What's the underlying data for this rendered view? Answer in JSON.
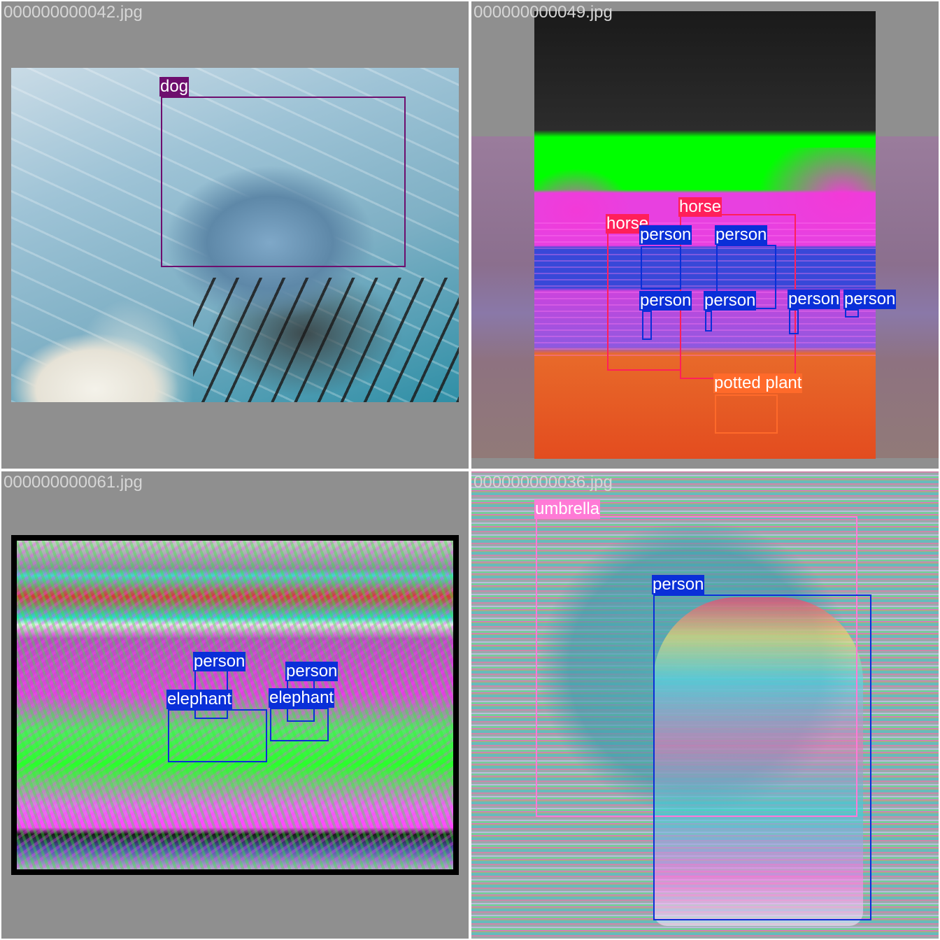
{
  "tiles": [
    {
      "filename": "000000000042.jpg",
      "detections": [
        {
          "label": "dog",
          "color": "#6e0e6e"
        }
      ]
    },
    {
      "filename": "000000000049.jpg",
      "detections": [
        {
          "label": "horse",
          "color": "#ff1f5a"
        },
        {
          "label": "horse",
          "color": "#ff1f5a"
        },
        {
          "label": "person",
          "color": "#0a2fd8"
        },
        {
          "label": "person",
          "color": "#0a2fd8"
        },
        {
          "label": "person",
          "color": "#0a2fd8"
        },
        {
          "label": "person",
          "color": "#0a2fd8"
        },
        {
          "label": "person",
          "color": "#0a2fd8"
        },
        {
          "label": "person",
          "color": "#0a2fd8"
        },
        {
          "label": "potted plant",
          "color": "#ff6a2a"
        }
      ]
    },
    {
      "filename": "000000000061.jpg",
      "detections": [
        {
          "label": "person",
          "color": "#0a2fd8"
        },
        {
          "label": "person",
          "color": "#0a2fd8"
        },
        {
          "label": "elephant",
          "color": "#0a2fd8"
        },
        {
          "label": "elephant",
          "color": "#0a2fd8"
        }
      ]
    },
    {
      "filename": "000000000036.jpg",
      "detections": [
        {
          "label": "umbrella",
          "color": "#ff7ad6"
        },
        {
          "label": "person",
          "color": "#0a2fd8"
        }
      ]
    }
  ]
}
